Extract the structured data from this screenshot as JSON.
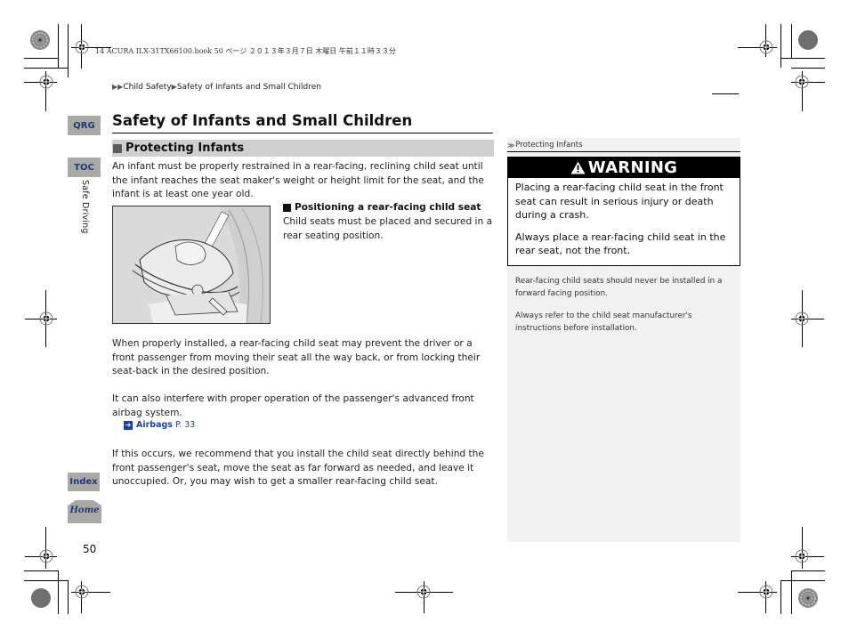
{
  "print_header": {
    "meta_line": "14 ACURA ILX-31TX66100.book  50 ページ  ２０１３年３月７日  木曜日  午前１１時３３分"
  },
  "breadcrumb": {
    "lead_arrows": "▶▶",
    "items": [
      "Child Safety",
      "Safety of Infants and Small Children"
    ],
    "separator": "▶"
  },
  "nav": {
    "qrg_label": "QRG",
    "toc_label": "TOC",
    "section_label": "Safe Driving",
    "index_label": "Index",
    "home_label": "Home"
  },
  "page_number": "50",
  "main": {
    "title": "Safety of Infants and Small Children",
    "section_heading": "Protecting Infants",
    "intro": "An infant must be properly restrained in a rear-facing, reclining child seat until the infant reaches the seat maker's weight or height limit for the seat, and the infant is at least one year old.",
    "figure_alt": "rear-facing child seat illustration",
    "subsection_heading": "Positioning a rear-facing child seat",
    "subsection_body": "Child seats must be placed and secured in a rear seating position.",
    "paragraph_2": "When properly installed, a rear-facing child seat may prevent the driver or a front passenger from moving their seat all the way back, or from locking their seat-back in the desired position.",
    "paragraph_3": "It can also interfere with proper operation of the passenger's advanced front airbag system.",
    "xref": {
      "icon": "➔",
      "label": "Airbags",
      "page": "P. 33"
    },
    "paragraph_4": "If this occurs, we recommend that you install the child seat directly behind the front passenger's seat, move the seat as far forward as needed, and leave it unoccupied. Or, you may wish to get a smaller rear-facing child seat."
  },
  "sidebar": {
    "header_icon": "≫",
    "header": "Protecting Infants",
    "warning": {
      "icon": "▲",
      "title": "WARNING",
      "paragraphs": [
        "Placing a rear-facing child seat in the front seat can result in serious injury or death during a crash.",
        "Always place a rear-facing child seat in the rear seat, not the front."
      ]
    },
    "notes": [
      "Rear-facing child seats should never be installed in a forward facing position.",
      "Always refer to the child seat manufacturer's instructions before installation."
    ]
  },
  "colors": {
    "nav_button_bg": "#a9aaa6",
    "nav_button_text": "#1d3b78",
    "link": "#1a3fb0",
    "section_bar": "#cfcfcf",
    "sidebar_bg": "#f1f1f1",
    "warning_header": "#000000"
  }
}
